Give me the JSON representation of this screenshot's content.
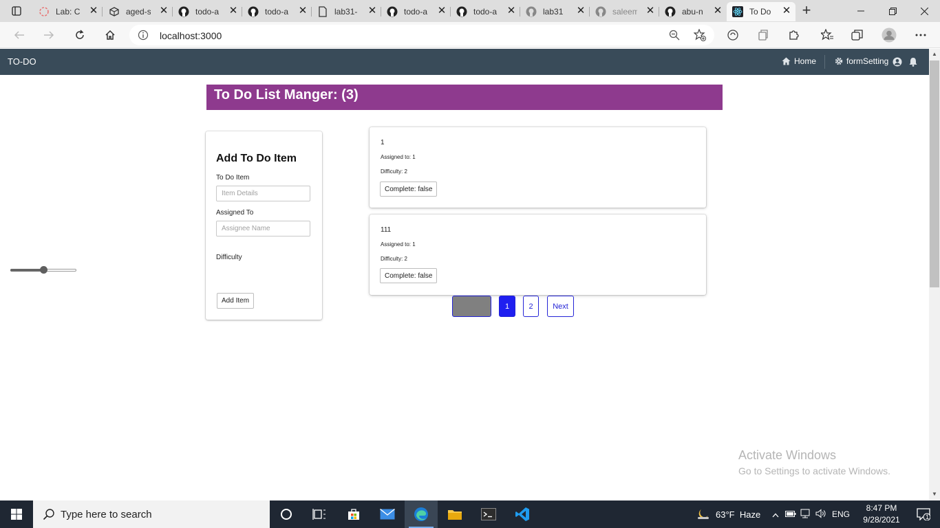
{
  "browser": {
    "tabs": [
      {
        "title": "Lab: Cl",
        "icon": "codefellows-icon"
      },
      {
        "title": "aged-s",
        "icon": "codesandbox-icon"
      },
      {
        "title": "todo-a",
        "icon": "github-icon"
      },
      {
        "title": "todo-a",
        "icon": "github-icon"
      },
      {
        "title": "lab31-",
        "icon": "document-icon"
      },
      {
        "title": "todo-a",
        "icon": "github-icon"
      },
      {
        "title": "todo-a",
        "icon": "github-icon"
      },
      {
        "title": "lab31",
        "icon": "github-icon"
      },
      {
        "title": "saleem",
        "icon": "github-icon"
      },
      {
        "title": "abu-n",
        "icon": "github-icon"
      },
      {
        "title": "To Do",
        "icon": "react-icon",
        "active": true
      }
    ],
    "url": "localhost:3000"
  },
  "app": {
    "brand": "TO-DO",
    "nav": {
      "home": "Home",
      "settings": "formSetting"
    },
    "heading": "To Do List Manger: (3)",
    "form": {
      "title": "Add To Do Item",
      "item_label": "To Do Item",
      "item_placeholder": "Item Details",
      "item_value": "",
      "assignee_label": "Assigned To",
      "assignee_placeholder": "Assignee Name",
      "assignee_value": "",
      "difficulty_label": "Difficulty",
      "difficulty_fraction": 0.5,
      "submit_label": "Add Item"
    },
    "todos": [
      {
        "text": "1",
        "assigned": "Assigned to: 1",
        "difficulty": "Difficulty: 2",
        "complete": "Complete: false"
      },
      {
        "text": "111",
        "assigned": "Assigned to: 1",
        "difficulty": "Difficulty: 2",
        "complete": "Complete: false"
      }
    ],
    "pagination": {
      "prev": "",
      "page1": "1",
      "page2": "2",
      "next": "Next"
    }
  },
  "watermark": {
    "line1": "Activate Windows",
    "line2": "Go to Settings to activate Windows."
  },
  "taskbar": {
    "search_placeholder": "Type here to search",
    "weather": "63°F  Haze",
    "language": "ENG",
    "time": "8:47 PM",
    "date": "9/28/2021",
    "notifications": "1"
  },
  "colors": {
    "appbar": "#394b59",
    "heading": "#8e3a8e",
    "pager_accent": "#1f1ff0"
  }
}
